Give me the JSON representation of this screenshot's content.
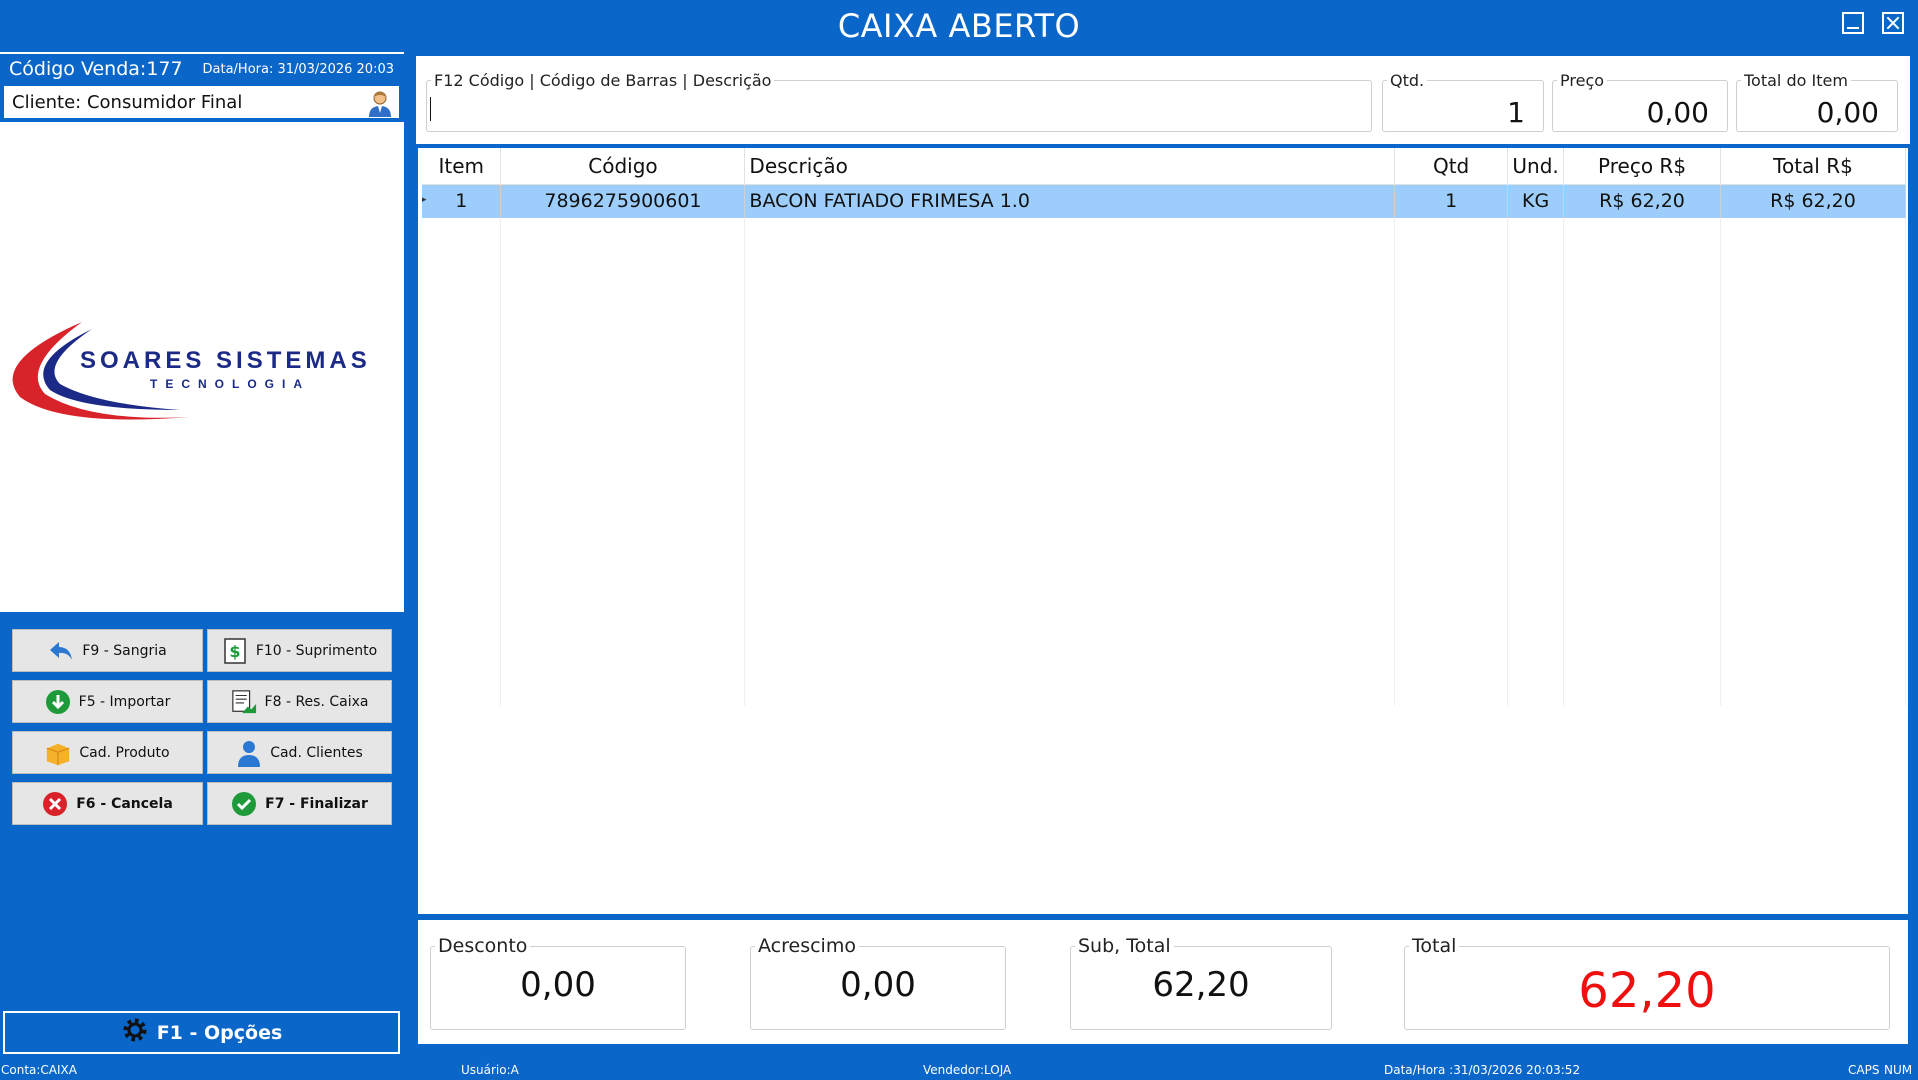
{
  "window": {
    "title": "CAIXA ABERTO"
  },
  "sale": {
    "code_label": "Código Venda:177",
    "datetime_label": "Data/Hora: 31/03/2026 20:03",
    "client_label": "Cliente: Consumidor Final"
  },
  "logo": {
    "line1": "SOARES SISTEMAS",
    "line2": "TECNOLOGIA"
  },
  "buttons": {
    "sangria": "F9 - Sangria",
    "suprimento": "F10 - Suprimento",
    "importar": "F5 - Importar",
    "res_caixa": "F8 - Res. Caixa",
    "cad_produto": "Cad. Produto",
    "cad_clientes": "Cad. Clientes",
    "cancela": "F6 - Cancela",
    "finalizar": "F7 - Finalizar",
    "opcoes": "F1 - Opções"
  },
  "inputs": {
    "search_legend": "F12  Código | Código de Barras | Descrição",
    "search_value": "",
    "qtd_legend": "Qtd.",
    "qtd_value": "1",
    "preco_legend": "Preço",
    "preco_value": "0,00",
    "total_item_legend": "Total do Item",
    "total_item_value": "0,00"
  },
  "grid": {
    "headers": [
      "Item",
      "Código",
      "Descrição",
      "Qtd",
      "Und.",
      "Preço R$",
      "Total R$"
    ],
    "rows": [
      [
        "1",
        "7896275900601",
        "BACON FATIADO FRIMESA 1.0",
        "1",
        "KG",
        "R$ 62,20",
        "R$ 62,20"
      ]
    ]
  },
  "totals": {
    "desconto_label": "Desconto",
    "desconto_value": "0,00",
    "acrescimo_label": "Acrescimo",
    "acrescimo_value": "0,00",
    "subtotal_label": "Sub, Total",
    "subtotal_value": "62,20",
    "total_label": "Total",
    "total_value": "62,20"
  },
  "status": {
    "conta": "Conta:CAIXA",
    "usuario": "Usuário:A",
    "vendedor": "Vendedor:LOJA",
    "datahora": "Data/Hora :31/03/2026 20:03:52",
    "caps": "CAPS",
    "num": "NUM"
  },
  "colors": {
    "brand_blue": "#0a66c8",
    "selected_row": "#9dcdfb",
    "total_red": "#ef0f0f",
    "logo_navy": "#1b2a86",
    "logo_red": "#d8232a"
  }
}
